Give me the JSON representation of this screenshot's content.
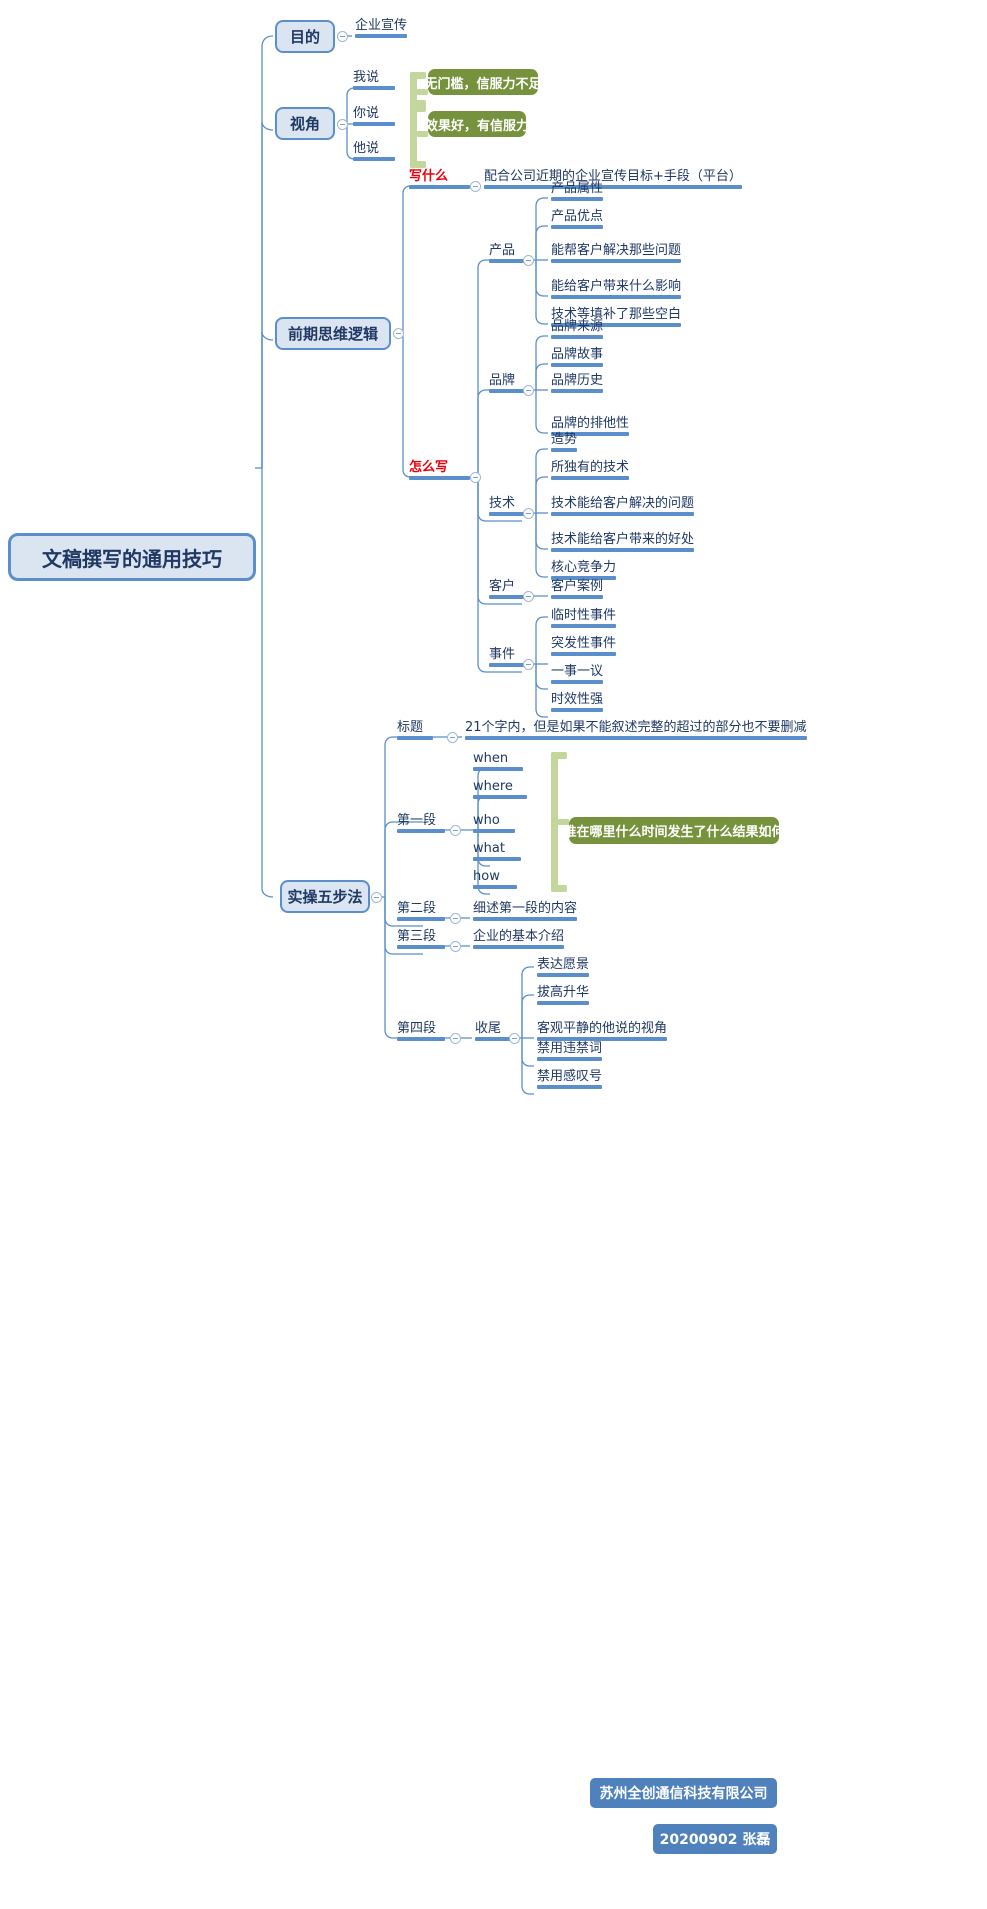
{
  "root": {
    "label": "文稿撰写的通用技巧"
  },
  "branches": [
    {
      "id": "mudi",
      "label": "目的"
    },
    {
      "id": "shijiao",
      "label": "视角"
    },
    {
      "id": "qianqi",
      "label": "前期思维逻辑"
    },
    {
      "id": "shicao",
      "label": "实操五步法"
    }
  ],
  "mudi": {
    "children": [
      {
        "label": "企业宣传"
      }
    ]
  },
  "shijiao": {
    "children": [
      {
        "label": "我说"
      },
      {
        "label": "你说"
      },
      {
        "label": "他说"
      }
    ],
    "callouts": [
      {
        "label": "无门槛，信服力不足"
      },
      {
        "label": "效果好，有信服力"
      }
    ]
  },
  "qianqi": {
    "xieshenme": {
      "label": "写什么",
      "detail": "配合公司近期的企业宣传目标+手段（平台）"
    },
    "zenmexie": {
      "label": "怎么写",
      "groups": [
        {
          "label": "产品",
          "items": [
            "产品属性",
            "产品优点",
            "能帮客户解决那些问题",
            "能给客户带来什么影响",
            "技术等填补了那些空白"
          ]
        },
        {
          "label": "品牌",
          "items": [
            "品牌来源",
            "品牌故事",
            "品牌历史",
            "品牌的排他性"
          ]
        },
        {
          "label": "技术",
          "items": [
            "造势",
            "所独有的技术",
            "技术能给客户解决的问题",
            "技术能给客户带来的好处",
            "核心竞争力"
          ]
        },
        {
          "label": "客户",
          "items": [
            "客户案例"
          ]
        },
        {
          "label": "事件",
          "items": [
            "临时性事件",
            "突发性事件",
            "一事一议",
            "时效性强"
          ]
        }
      ]
    }
  },
  "shicao": {
    "steps": [
      {
        "label": "标题",
        "detail": "21个字内，但是如果不能叙述完整的超过的部分也不要删减"
      },
      {
        "label": "第一段",
        "items": [
          "when",
          "where",
          "who",
          "what",
          "how"
        ],
        "callout": "谁在哪里什么时间发生了什么结果如何"
      },
      {
        "label": "第二段",
        "detail": "细述第一段的内容"
      },
      {
        "label": "第三段",
        "detail": "企业的基本介绍"
      },
      {
        "label": "第四段",
        "sub": {
          "label": "收尾",
          "items": [
            "表达愿景",
            "拔高升华",
            "客观平静的他说的视角",
            "禁用违禁词",
            "禁用感叹号"
          ]
        }
      }
    ]
  },
  "footer": {
    "company": "苏州全创通信科技有限公司",
    "signature": "20200902  张磊"
  },
  "colors": {
    "node_line": "#5b8fcb",
    "box_fill": "#dbe5f1",
    "box_border": "#5b8fcb",
    "green_callout": "#76923c",
    "green_bracket": "#c3d69b",
    "footer_blue": "#4f81bd",
    "red_text": "#e8000b",
    "text": "#1f3864"
  }
}
